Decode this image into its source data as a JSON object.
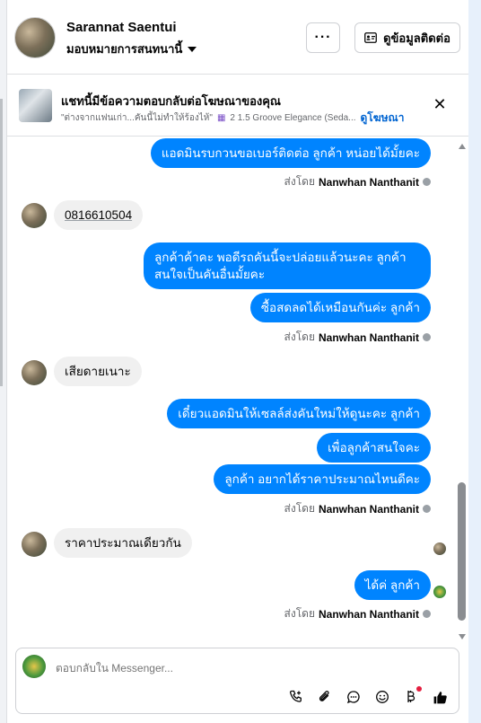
{
  "header": {
    "name": "Sarannat Saentui",
    "assign_label": "มอบหมายการสนทนานี้",
    "more_label": "···",
    "contact_label": "ดูข้อมูลติดต่อ"
  },
  "ad_banner": {
    "title": "แชทนี้มีข้อความตอบกลับต่อโฆษณาของคุณ",
    "quote": "\"ต่างจากแฟนเก่า...คันนี้ไม่ทำให้ร้องไห้\"",
    "car_label": "2 1.5 Groove Elegance (Seda...",
    "link_label": "ดูโฆษณา",
    "close_icon": "close-icon"
  },
  "messages": {
    "m1": "แอดมินรบกวนขอเบอร์ติดต่อ ลูกค้า หน่อยได้มั้ยคะ",
    "m2": "0816610504",
    "m3": "ลูกค้าค้าคะ พอดีรถคันนี้จะปล่อยแล้วนะคะ ลูกค้าสนใจเป็นคันอื่นมั้ยคะ",
    "m4": "ซื้อสดลดได้เหมือนกันค่ะ ลูกค้า",
    "m5": "เสียดายเนาะ",
    "m6": "เดี๋ยวแอดมินให้เซลล์ส่งคันใหม่ให้ดูนะคะ ลูกค้า",
    "m7": "เพื่อลูกค้าสนใจคะ",
    "m8": "ลูกค้า อยากได้ราคาประมาณไหนดีคะ",
    "m9": "ราคาประมาณเดียวกัน",
    "m10": "ได้ค่ ลูกค้า"
  },
  "sender": {
    "prefix": "ส่งโดย",
    "name": "Nanwhan Nanthanit"
  },
  "composer": {
    "placeholder": "ตอบกลับใน Messenger..."
  },
  "colors": {
    "outgoing_bubble": "#0084ff",
    "incoming_bubble": "#f0f0f0",
    "link": "#0064d1"
  }
}
